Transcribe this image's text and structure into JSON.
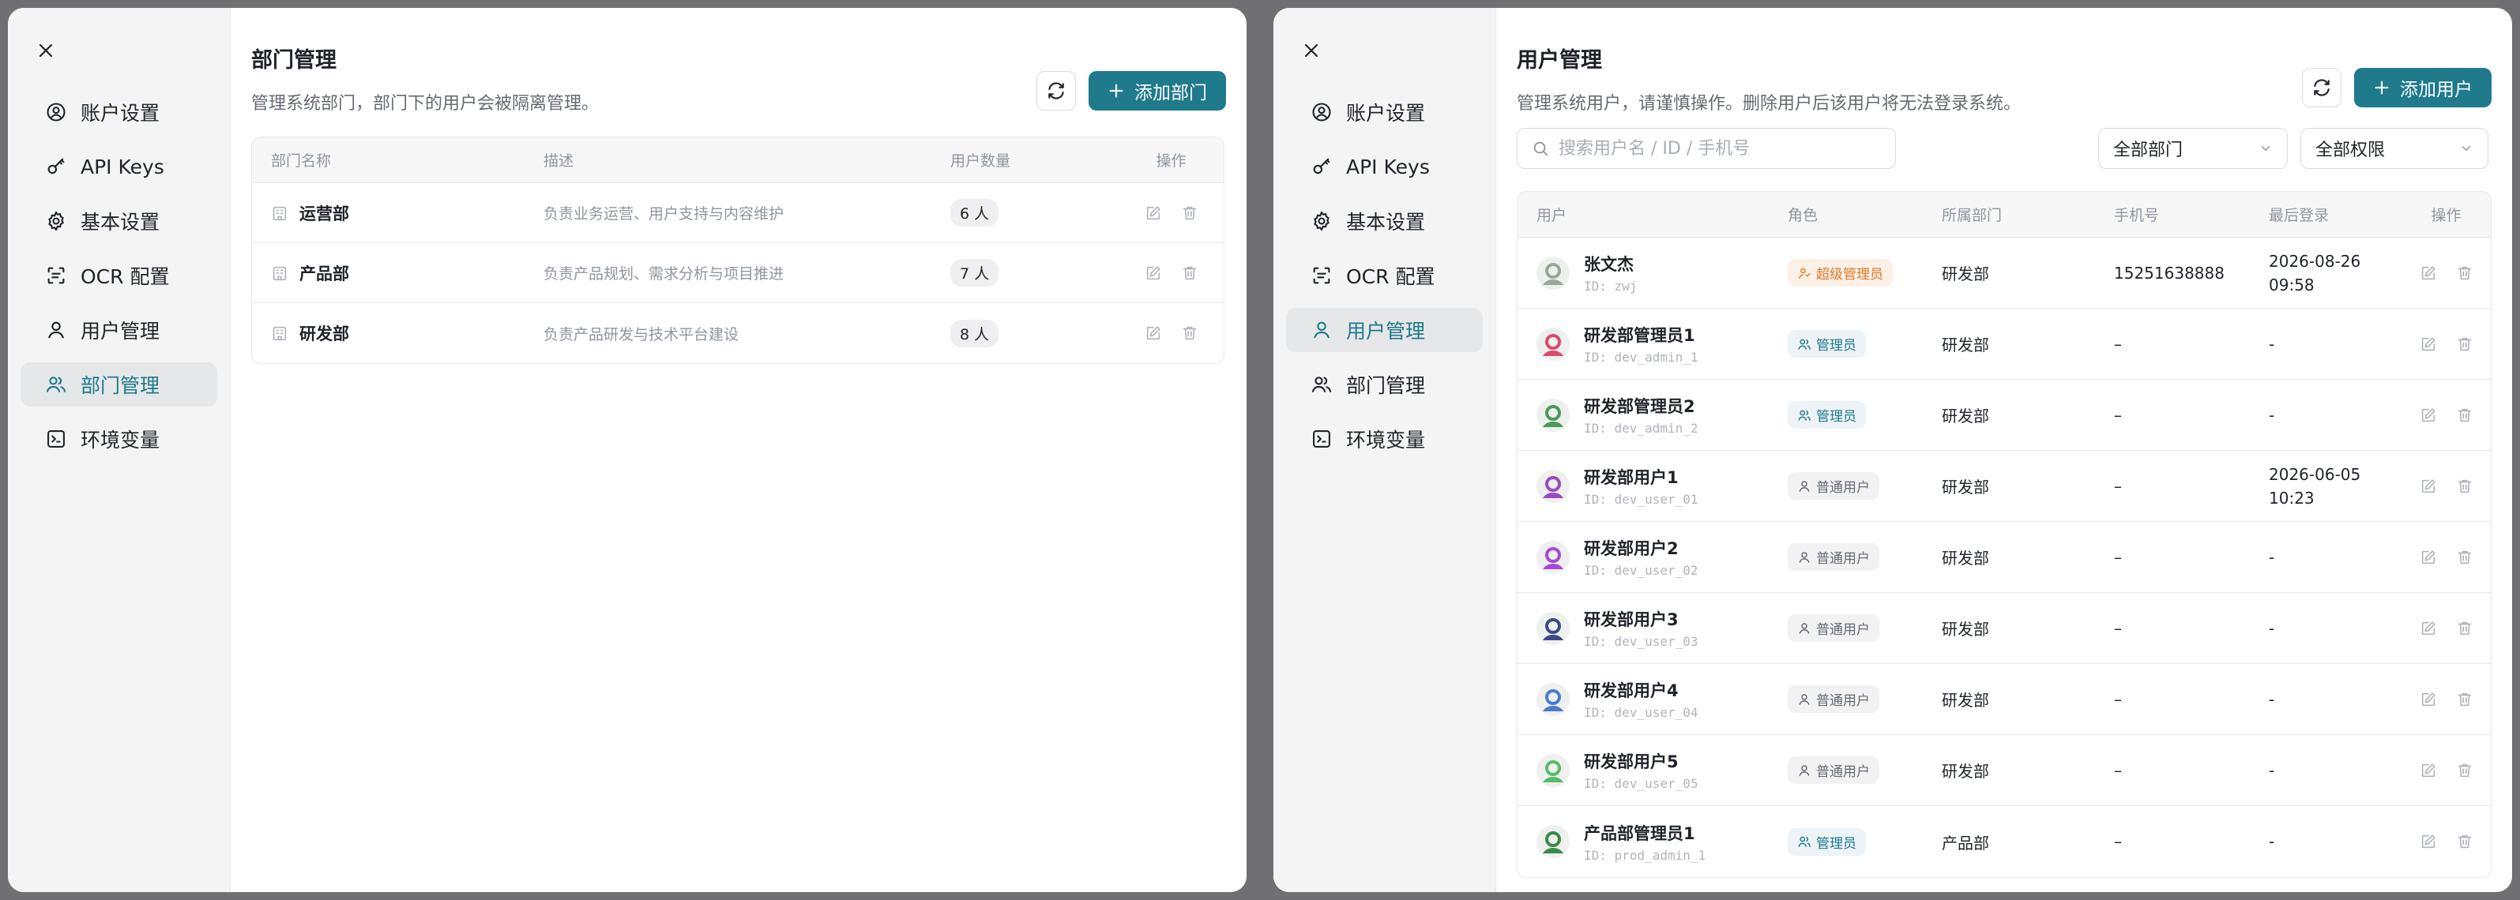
{
  "left_modal": {
    "nav": [
      {
        "label": "账户设置",
        "icon": "user-circle-icon",
        "active": false
      },
      {
        "label": "API Keys",
        "icon": "key-icon",
        "active": false
      },
      {
        "label": "基本设置",
        "icon": "gear-icon",
        "active": false
      },
      {
        "label": "OCR 配置",
        "icon": "scan-icon",
        "active": false
      },
      {
        "label": "用户管理",
        "icon": "user-icon",
        "active": false
      },
      {
        "label": "部门管理",
        "icon": "users-icon",
        "active": true
      },
      {
        "label": "环境变量",
        "icon": "terminal-icon",
        "active": false
      }
    ],
    "title": "部门管理",
    "subtitle": "管理系统部门，部门下的用户会被隔离管理。",
    "add_button": "添加部门",
    "columns": [
      "部门名称",
      "描述",
      "用户数量",
      "操作"
    ],
    "rows": [
      {
        "name": "运营部",
        "desc": "负责业务运营、用户支持与内容维护",
        "count": "6 人"
      },
      {
        "name": "产品部",
        "desc": "负责产品规划、需求分析与项目推进",
        "count": "7 人"
      },
      {
        "name": "研发部",
        "desc": "负责产品研发与技术平台建设",
        "count": "8 人"
      }
    ]
  },
  "right_modal": {
    "nav": [
      {
        "label": "账户设置",
        "icon": "user-circle-icon",
        "active": false
      },
      {
        "label": "API Keys",
        "icon": "key-icon",
        "active": false
      },
      {
        "label": "基本设置",
        "icon": "gear-icon",
        "active": false
      },
      {
        "label": "OCR 配置",
        "icon": "scan-icon",
        "active": false
      },
      {
        "label": "用户管理",
        "icon": "user-icon",
        "active": true
      },
      {
        "label": "部门管理",
        "icon": "users-icon",
        "active": false
      },
      {
        "label": "环境变量",
        "icon": "terminal-icon",
        "active": false
      }
    ],
    "title": "用户管理",
    "subtitle": "管理系统用户，请谨慎操作。删除用户后该用户将无法登录系统。",
    "add_button": "添加用户",
    "search_placeholder": "搜索用户名 / ID / 手机号",
    "department_filter": "全部部门",
    "role_filter": "全部权限",
    "columns": [
      "用户",
      "角色",
      "所属部门",
      "手机号",
      "最后登录",
      "操作"
    ],
    "users": [
      {
        "name": "张文杰",
        "id": "ID: zwj",
        "role": "超级管理员",
        "role_type": "super",
        "dept": "研发部",
        "phone": "15251638888",
        "last_login_1": "2026-08-26",
        "last_login_2": "09:58",
        "avatar_color": "#9aa69a"
      },
      {
        "name": "研发部管理员1",
        "id": "ID: dev_admin_1",
        "role": "管理员",
        "role_type": "admin",
        "dept": "研发部",
        "phone": "–",
        "last_login_1": "-",
        "last_login_2": "",
        "avatar_color": "#d94a6a"
      },
      {
        "name": "研发部管理员2",
        "id": "ID: dev_admin_2",
        "role": "管理员",
        "role_type": "admin",
        "dept": "研发部",
        "phone": "–",
        "last_login_1": "-",
        "last_login_2": "",
        "avatar_color": "#4a9a5a"
      },
      {
        "name": "研发部用户1",
        "id": "ID: dev_user_01",
        "role": "普通用户",
        "role_type": "user",
        "dept": "研发部",
        "phone": "–",
        "last_login_1": "2026-06-05",
        "last_login_2": "10:23",
        "avatar_color": "#9a4ac0"
      },
      {
        "name": "研发部用户2",
        "id": "ID: dev_user_02",
        "role": "普通用户",
        "role_type": "user",
        "dept": "研发部",
        "phone": "–",
        "last_login_1": "-",
        "last_login_2": "",
        "avatar_color": "#a64ad0"
      },
      {
        "name": "研发部用户3",
        "id": "ID: dev_user_03",
        "role": "普通用户",
        "role_type": "user",
        "dept": "研发部",
        "phone": "–",
        "last_login_1": "-",
        "last_login_2": "",
        "avatar_color": "#3a4a8a"
      },
      {
        "name": "研发部用户4",
        "id": "ID: dev_user_04",
        "role": "普通用户",
        "role_type": "user",
        "dept": "研发部",
        "phone": "–",
        "last_login_1": "-",
        "last_login_2": "",
        "avatar_color": "#4a7ad0"
      },
      {
        "name": "研发部用户5",
        "id": "ID: dev_user_05",
        "role": "普通用户",
        "role_type": "user",
        "dept": "研发部",
        "phone": "–",
        "last_login_1": "-",
        "last_login_2": "",
        "avatar_color": "#5aba6a"
      },
      {
        "name": "产品部管理员1",
        "id": "ID: prod_admin_1",
        "role": "管理员",
        "role_type": "admin",
        "dept": "产品部",
        "phone": "–",
        "last_login_1": "-",
        "last_login_2": "",
        "avatar_color": "#3a8a4a"
      }
    ]
  },
  "colors": {
    "accent": "#1f7a8c",
    "active_bg": "#e6e7e9",
    "super_admin": "#e0792a"
  }
}
